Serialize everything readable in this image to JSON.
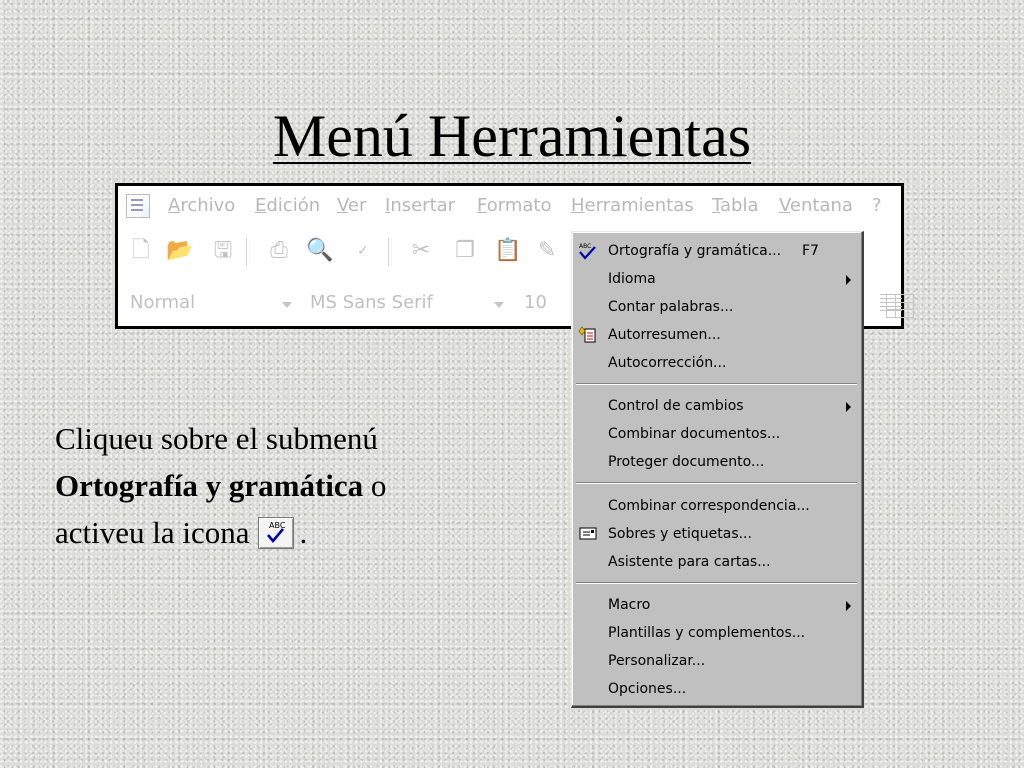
{
  "slide": {
    "title": "Menú Herramientas",
    "body": {
      "line1": "Cliqueu sobre el submenú",
      "bold": "Ortografía y gramática",
      "after_bold": " o",
      "line3_prefix": "activeu la icona",
      "line3_suffix": "."
    }
  },
  "menubar": {
    "items": [
      "Archivo",
      "Edición",
      "Ver",
      "Insertar",
      "Formato",
      "Herramientas",
      "Tabla",
      "Ventana",
      "?"
    ]
  },
  "toolbar": {
    "icons": [
      "new-document-icon",
      "open-folder-icon",
      "save-icon",
      "print-icon",
      "print-preview-icon",
      "spelling-icon",
      "cut-icon",
      "copy-icon",
      "paste-icon",
      "format-painter-icon",
      "table-icon"
    ]
  },
  "format_bar": {
    "style": "Normal",
    "font": "MS Sans Serif",
    "size": "10"
  },
  "dropdown": {
    "items": [
      {
        "label": "Ortografía y gramática...",
        "shortcut": "F7",
        "icon": "spelling-check-icon"
      },
      {
        "label": "Idioma",
        "submenu": true
      },
      {
        "label": "Contar palabras..."
      },
      {
        "label": "Autorresumen...",
        "icon": "autosummarize-icon"
      },
      {
        "label": "Autocorrección..."
      },
      {
        "label": "Control de cambios",
        "submenu": true
      },
      {
        "label": "Combinar documentos..."
      },
      {
        "label": "Proteger documento..."
      },
      {
        "label": "Combinar correspondencia..."
      },
      {
        "label": "Sobres y etiquetas...",
        "icon": "envelope-icon"
      },
      {
        "label": "Asistente para cartas..."
      },
      {
        "label": "Macro",
        "submenu": true
      },
      {
        "label": "Plantillas y complementos..."
      },
      {
        "label": "Personalizar..."
      },
      {
        "label": "Opciones..."
      }
    ]
  },
  "colors": {
    "menu_bg": "#c0c0c0",
    "disabled_text": "#b8b8b8",
    "slide_bg": "#dcdcd8"
  }
}
